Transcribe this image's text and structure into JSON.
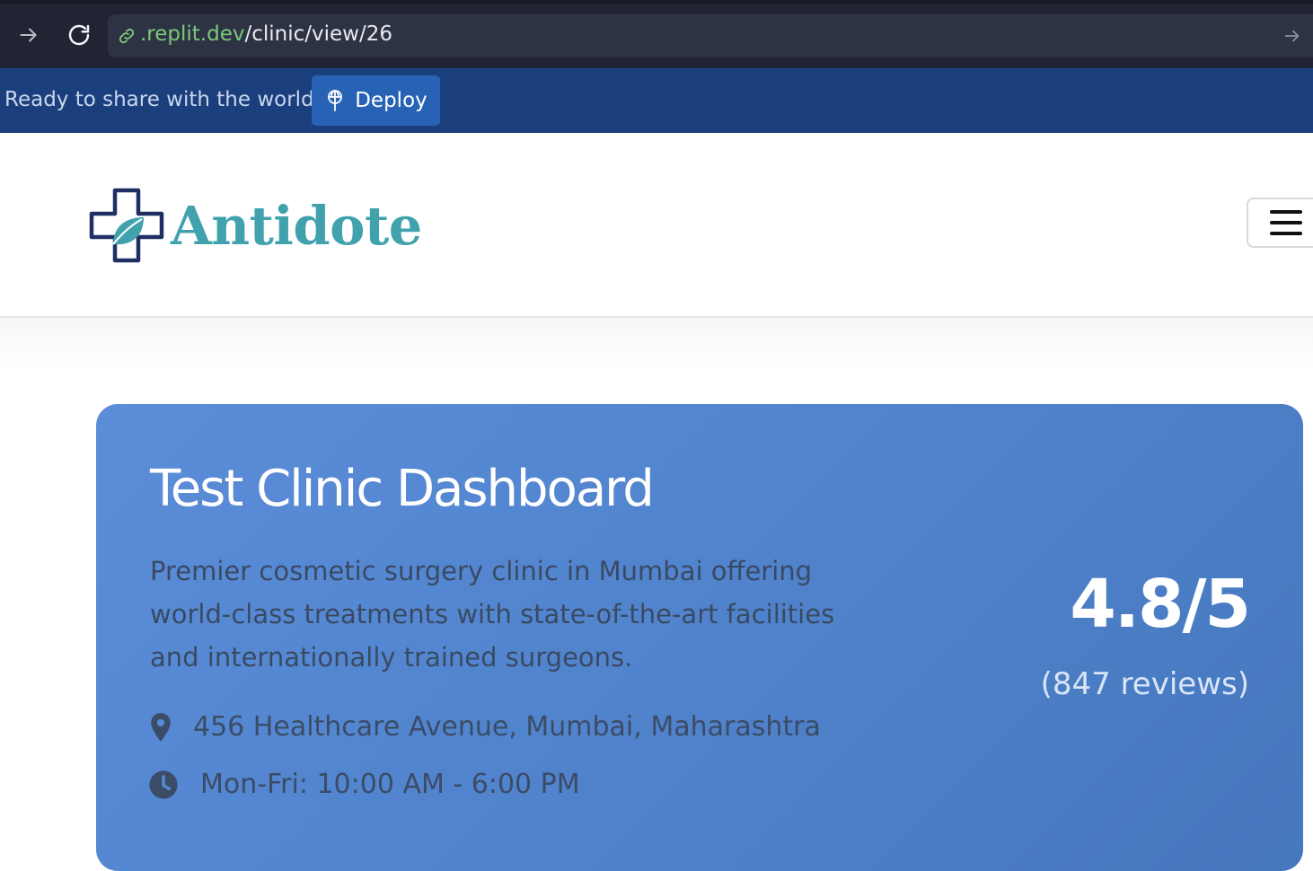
{
  "browser": {
    "url_host": ".replit.dev",
    "url_path": "/clinic/view/26",
    "icons": {
      "forward": "arrow-right-icon",
      "reload": "reload-icon",
      "link": "link-icon",
      "go": "arrow-right-icon"
    }
  },
  "deploy_banner": {
    "text": "Ready to share with the world?",
    "button_label": "Deploy",
    "button_icon": "deploy-icon",
    "background": "#1a3f7c",
    "button_color": "#2862b5"
  },
  "header": {
    "brand": "Antidote",
    "brand_color": "#41a2ad",
    "menu_icon": "hamburger-icon"
  },
  "clinic": {
    "title": "Test Clinic Dashboard",
    "description": "Premier cosmetic surgery clinic in Mumbai offering world-class treatments with state-of-the-art facilities and internationally trained surgeons.",
    "address": "456 Healthcare Avenue, Mumbai, Maharashtra",
    "hours": "Mon-Fri: 10:00 AM - 6:00 PM",
    "rating": "4.8/5",
    "reviews": "(847 reviews)",
    "address_icon": "location-pin-icon",
    "hours_icon": "clock-icon",
    "card_color": "#5285d0"
  }
}
